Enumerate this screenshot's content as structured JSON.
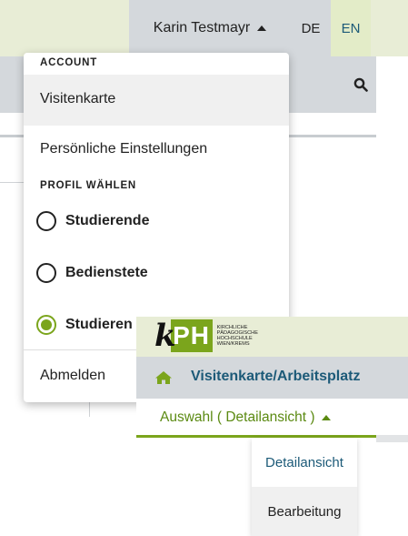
{
  "header": {
    "user_name": "Karin Testmayr",
    "languages": [
      "DE",
      "EN"
    ]
  },
  "dropdown": {
    "account_header": "ACCOUNT",
    "business_card": "Visitenkarte",
    "personal_settings": "Persönliche Einstellungen",
    "profile_header": "PROFIL WÄHLEN",
    "profiles": [
      {
        "label": "Studierende",
        "checked": false
      },
      {
        "label": "Bedienstete",
        "checked": false
      },
      {
        "label": "Studieren",
        "checked": true
      }
    ],
    "logout": "Abmelden"
  },
  "inset": {
    "logo": {
      "mark": "PH",
      "k": "k",
      "lines": [
        "KIRCHLICHE",
        "PÄDAGOGISCHE",
        "HOCHSCHULE",
        "WIEN/KREMS"
      ]
    },
    "nav_title": "Visitenkarte/Arbeitsplatz",
    "selection_label": "Auswahl ( Detailansicht )",
    "submenu": [
      "Detailansicht",
      "Bearbeitung"
    ]
  },
  "colors": {
    "accent_green": "#7ba51c",
    "link_blue": "#1c5a78",
    "topbar_bg": "#e8edd6",
    "nav_grey": "#d4d8dc"
  },
  "icons": {
    "search": "search-icon",
    "home": "home-icon",
    "caret": "caret-up-icon"
  }
}
